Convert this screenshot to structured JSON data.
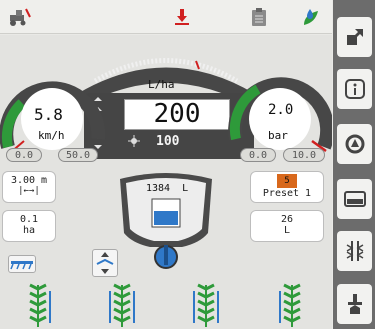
{
  "rate": {
    "unit": "L/ha",
    "target": "200",
    "actual": "100"
  },
  "speed": {
    "value": "5.8",
    "unit": "km/h",
    "min": "0.0",
    "max": "50.0",
    "level": 0.12
  },
  "pressure": {
    "value": "2.0",
    "unit": "bar",
    "min": "0.0",
    "max": "10.0",
    "level": 0.2
  },
  "width": {
    "value": "3.00  m"
  },
  "area": {
    "value": "0.1",
    "unit": "ha"
  },
  "preset": {
    "number": "5",
    "label": "Preset 1"
  },
  "tank": {
    "volume": "1384",
    "unit": "L"
  },
  "applied": {
    "value": "26",
    "unit": "L"
  },
  "colors": {
    "accent_green": "#2e9a3a",
    "accent_red": "#d02020",
    "accent_blue": "#2f78c8",
    "preset_orange": "#d8681c"
  },
  "icons": {
    "top": [
      "tractor-fault-icon",
      "nozzle-icon",
      "clipboard-icon",
      "plant-water-icon"
    ],
    "sidebar": [
      "expand-icon",
      "info-icon",
      "auto-rate-icon",
      "tank-icon",
      "boom-sections-icon",
      "settings-nozzle-icon"
    ]
  }
}
